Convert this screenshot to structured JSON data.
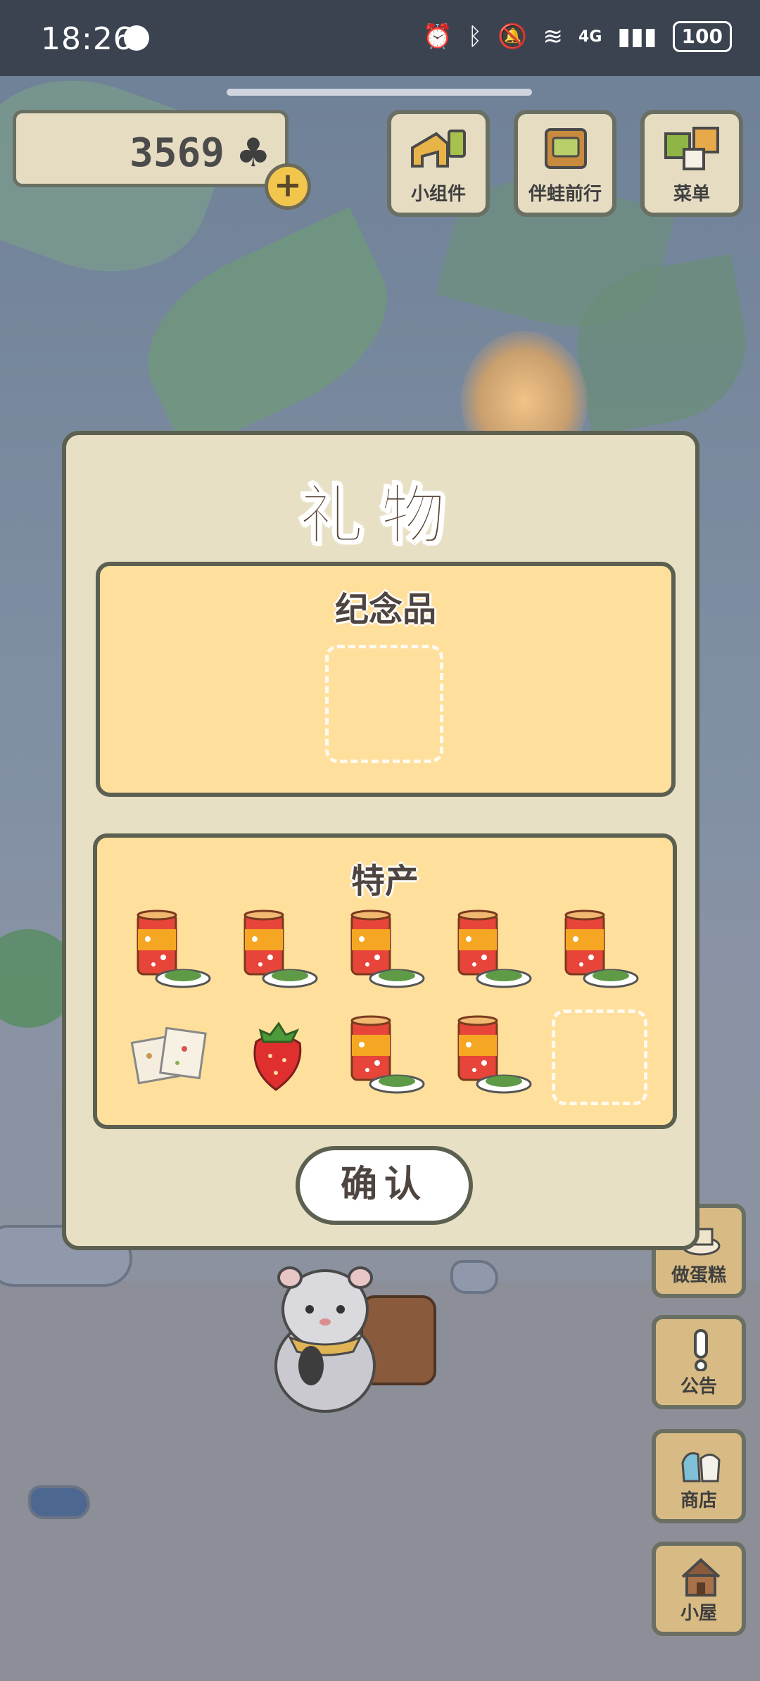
{
  "status_bar": {
    "time": "18:26",
    "network": "4G",
    "battery": "100"
  },
  "hud": {
    "clovers": "3569",
    "clover_symbol": "♣",
    "plus_symbol": "+",
    "top_buttons": [
      {
        "label": "小组件",
        "icon": "widget-icon"
      },
      {
        "label": "伴蛙前行",
        "icon": "album-icon"
      },
      {
        "label": "菜单",
        "icon": "menu-icon"
      }
    ],
    "side_buttons": [
      {
        "label": "做蛋糕",
        "icon": "cake-icon"
      },
      {
        "label": "公告",
        "icon": "exclamation-icon"
      },
      {
        "label": "商店",
        "icon": "bag-icon"
      },
      {
        "label": "小屋",
        "icon": "house-icon"
      }
    ]
  },
  "dialog": {
    "title": "礼物",
    "souvenir": {
      "title": "纪念品"
    },
    "specialty": {
      "title": "特产",
      "items": [
        "canned-food",
        "canned-food",
        "canned-food",
        "canned-food",
        "canned-food",
        "rice-cake",
        "strawberry",
        "canned-food",
        "canned-food",
        "empty"
      ]
    },
    "confirm_label": "确认"
  },
  "colors": {
    "dialog_bg": "#e8e0c4",
    "panel_bg": "#ffdf9c",
    "border": "#5c6050"
  }
}
